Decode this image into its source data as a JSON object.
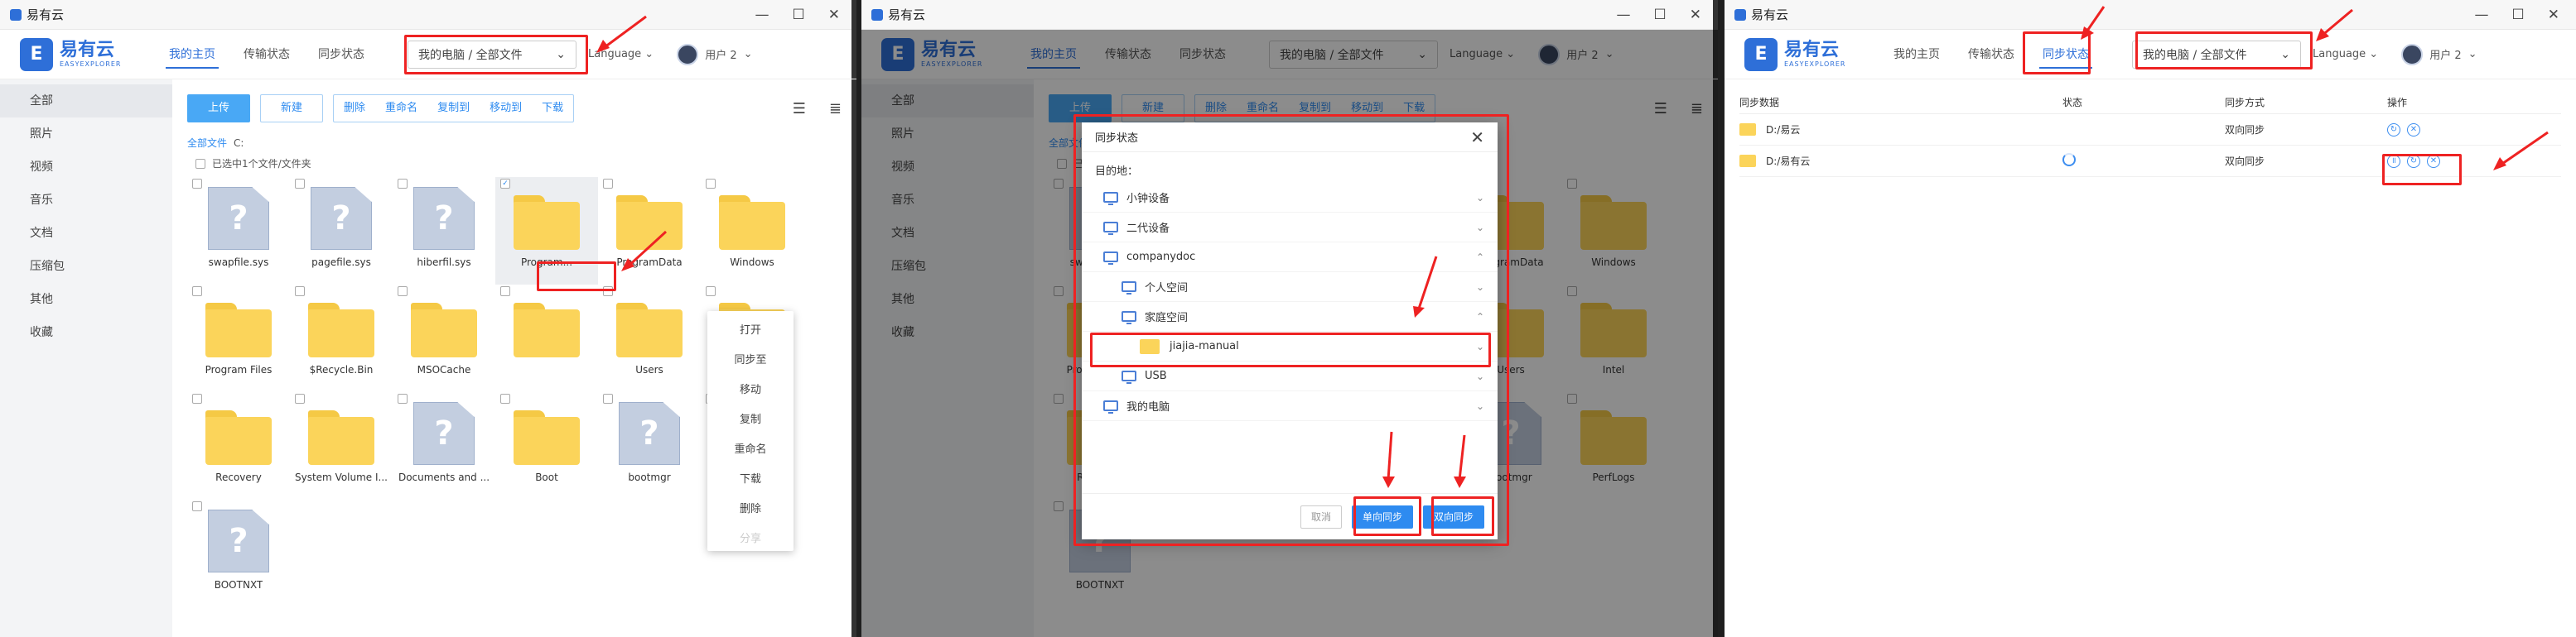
{
  "app": {
    "title": "易有云",
    "logo_cn": "易有云",
    "logo_en": "EASYEXPLORER",
    "nav": [
      "我的主页",
      "传输状态",
      "同步状态"
    ],
    "path": "我的电脑 / 全部文件",
    "language": "Language",
    "user": "用户 2",
    "sidebar": [
      "全部",
      "照片",
      "视频",
      "音乐",
      "文档",
      "压缩包",
      "其他",
      "收藏"
    ],
    "toolbar": {
      "upload": "上传",
      "new": "新建",
      "group": [
        "删除",
        "重命名",
        "复制到",
        "移动到",
        "下载"
      ]
    },
    "crumb_root": "全部文件",
    "crumb_path": "C:",
    "select_info": "已选中1个文件/文件夹",
    "accent": "#2e6fd8",
    "highlight": "#e22222"
  },
  "panel1": {
    "files": [
      {
        "name": "swapfile.sys",
        "type": "file"
      },
      {
        "name": "pagefile.sys",
        "type": "file"
      },
      {
        "name": "hiberfil.sys",
        "type": "file"
      },
      {
        "name": "Program...",
        "type": "folder"
      },
      {
        "name": "ProgramData",
        "type": "folder"
      },
      {
        "name": "Windows",
        "type": "folder"
      },
      {
        "name": "Program Files",
        "type": "folder"
      },
      {
        "name": "$Recycle.Bin",
        "type": "folder"
      },
      {
        "name": "MSOCache",
        "type": "folder"
      },
      {
        "name": "",
        "type": "folder"
      },
      {
        "name": "Users",
        "type": "folder"
      },
      {
        "name": "Intel",
        "type": "folder"
      },
      {
        "name": "Recovery",
        "type": "folder"
      },
      {
        "name": "System Volume I...",
        "type": "folder"
      },
      {
        "name": "Documents and ...",
        "type": "file"
      },
      {
        "name": "Boot",
        "type": "folder"
      },
      {
        "name": "bootmgr",
        "type": "file"
      },
      {
        "name": "PerfLogs",
        "type": "folder"
      },
      {
        "name": "BOOTNXT",
        "type": "file"
      }
    ],
    "context_menu": [
      "打开",
      "同步至",
      "移动",
      "复制",
      "重命名",
      "下载",
      "删除",
      "分享"
    ]
  },
  "panel2": {
    "dialog": {
      "title": "同步状态",
      "destination_label": "目的地：",
      "tree": [
        {
          "label": "小钟设备",
          "indent": 0,
          "kind": "pc"
        },
        {
          "label": "二代设备",
          "indent": 0,
          "kind": "pc"
        },
        {
          "label": "companydoc",
          "indent": 0,
          "kind": "pc"
        },
        {
          "label": "个人空间",
          "indent": 1,
          "kind": "pc"
        },
        {
          "label": "家庭空间",
          "indent": 1,
          "kind": "pc"
        },
        {
          "label": "jiajia-manual",
          "indent": 2,
          "kind": "folder"
        },
        {
          "label": "USB",
          "indent": 1,
          "kind": "pc"
        },
        {
          "label": "我的电脑",
          "indent": 0,
          "kind": "pc"
        }
      ],
      "cancel": "取消",
      "one_way": "单向同步",
      "two_way": "双向同步"
    }
  },
  "panel3": {
    "headers": [
      "同步数据",
      "状态",
      "同步方式",
      "操作"
    ],
    "rows": [
      {
        "path": "D:/易云",
        "mode": "双向同步",
        "status": ""
      },
      {
        "path": "D:/易有云",
        "mode": "双向同步",
        "status": "syncing"
      }
    ]
  }
}
